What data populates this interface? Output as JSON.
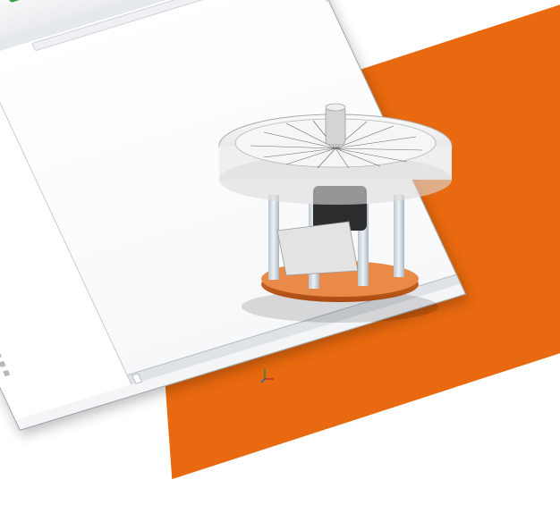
{
  "ribbon": [
    "",
    "",
    "",
    "",
    "",
    "",
    "",
    "",
    "",
    "",
    ""
  ],
  "tabs": [
    "",
    "",
    "",
    "",
    ""
  ],
  "tree": {
    "root": "",
    "items": [
      "",
      "",
      "",
      "",
      "",
      "",
      "",
      "",
      "",
      "",
      "",
      "",
      "",
      "",
      "",
      "",
      "",
      "",
      "",
      "",
      "",
      "",
      "",
      "",
      "",
      "",
      "",
      "",
      "",
      "",
      ""
    ]
  },
  "bottom_tabs": [
    "",
    ""
  ],
  "colors": {
    "accent_orange": "#e8690f",
    "base_plate": "#e0752b",
    "motor": "#2d2d30"
  },
  "icons": [
    "assembly-icon",
    "folder-icon",
    "sensor-icon",
    "annotation-icon",
    "plane-icon",
    "origin-icon",
    "part-icon",
    "fastener-icon",
    "view-triad-icon"
  ]
}
